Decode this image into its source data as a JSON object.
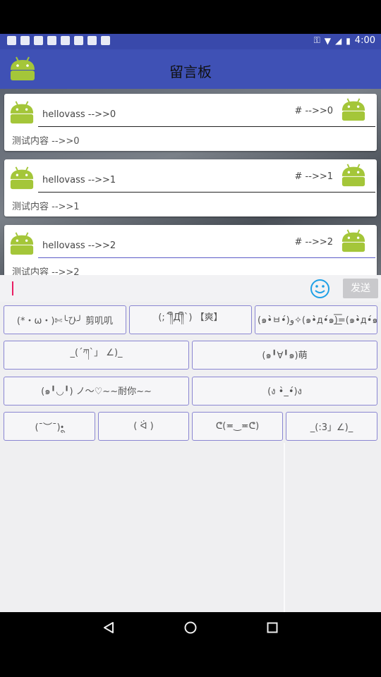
{
  "status_bar": {
    "time": "4:00"
  },
  "app_bar": {
    "title": "留言板"
  },
  "messages": [
    {
      "name": "hellovass -->>0",
      "floor": "# -->>0",
      "body": "测试内容 -->>0"
    },
    {
      "name": "hellovass -->>1",
      "floor": "# -->>1",
      "body": "测试内容 -->>1"
    },
    {
      "name": "hellovass -->>2",
      "floor": "# -->>2",
      "body": "测试内容 -->>2"
    }
  ],
  "input": {
    "value": "",
    "send_label": "发送"
  },
  "emoticons": {
    "row1": [
      "(*・ω・)✄╰ひ╯ 剪叽叽",
      "(;´༎ຶД༎ຶ`) 【爽】",
      "(๑•̀ㅂ•́)و✧(๑•̀д•́๑)=͟͟͞͞(๑•̀д•́๑)=͟͟͞͞(๑•̀д•́๑"
    ],
    "row2": [
      "_(´ཀ`」 ∠)_",
      "(๑╹∀╹๑)萌"
    ],
    "row3": [
      "(๑╹◡╹) ノ～♡~~耐你~~",
      "(ง •̀_•́)ง"
    ],
    "row4": [
      "(¯︶¯)•ू",
      "( ᐛ )",
      "ᕦ(≖‿≖ᕦ)",
      "_(:3」∠)_"
    ]
  },
  "colors": {
    "primary": "#3f51b5",
    "status": "#3949ab",
    "accent": "#e91e63",
    "emoticon_border": "#8a86d2",
    "android_green": "#a4c639"
  },
  "icons": {
    "avatar": "android-robot-icon",
    "emoji": "smiley-icon",
    "back": "back-triangle-icon",
    "home": "home-circle-icon",
    "recents": "recents-square-icon"
  }
}
